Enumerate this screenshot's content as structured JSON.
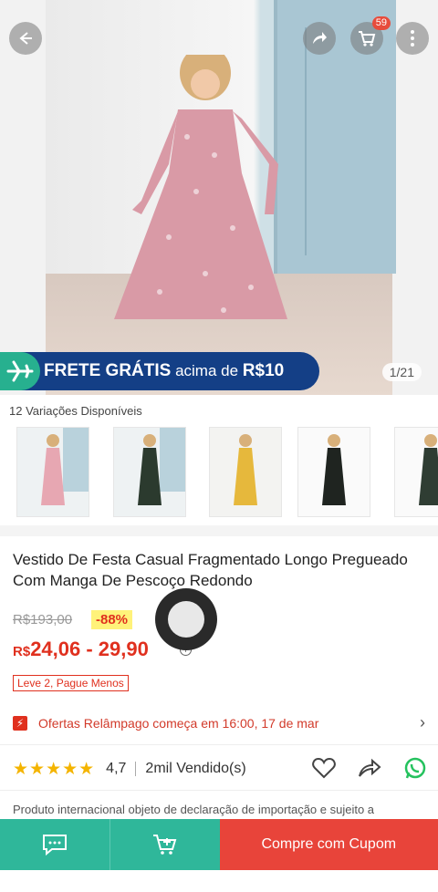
{
  "header": {
    "cart_count": "59"
  },
  "hero": {
    "image_counter": "1/21",
    "banner_bold": "FRETE GRÁTIS",
    "banner_light": " acima de ",
    "banner_amount": "R$10"
  },
  "variations": {
    "label": "12 Variações Disponíveis",
    "colors": [
      "#e7a7b2",
      "#2b3a2e",
      "#e6b83c",
      "#1f2420",
      "#2f3d33"
    ]
  },
  "product": {
    "title": "Vestido De Festa Casual Fragmentado Longo Pregueado Com Manga De Pescoço Redondo",
    "old_price": "R$193,00",
    "discount": "-88%",
    "price_currency": "R$",
    "price_range": "24,06 - 29,90",
    "promo_tag": "Leve 2, Pague Menos"
  },
  "flash": {
    "text": "Ofertas Relâmpago começa em 16:00, 17 de mar"
  },
  "stats": {
    "rating": "4,7",
    "sold": "2mil Vendido(s)"
  },
  "disclaimer": "Produto internacional objeto de declaração de importação e sujeito a",
  "bottom_bar": {
    "buy_label": "Compre com Cupom"
  },
  "colors": {
    "accent_green": "#2fb79a",
    "accent_red": "#e8443a",
    "price_red": "#e0301e",
    "banner_blue": "#143f86"
  }
}
